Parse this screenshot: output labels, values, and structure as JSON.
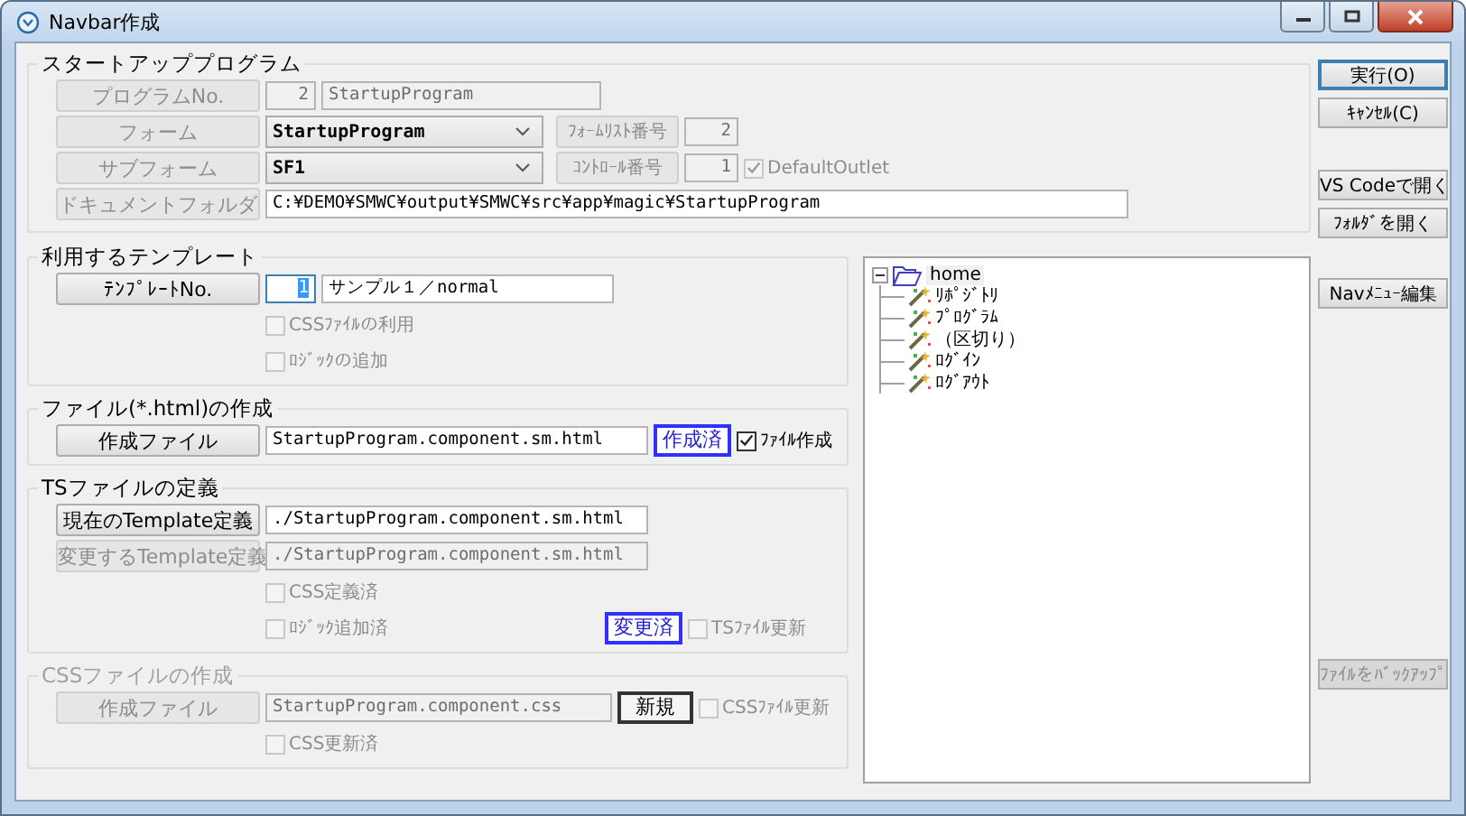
{
  "window": {
    "title": "Navbar作成"
  },
  "startup": {
    "legend": "スタートアッププログラム",
    "program_button": {
      "label": "プログラムNo.",
      "disabled": true
    },
    "program_no": "2",
    "program_name": "StartupProgram",
    "form_button": {
      "label": "フォーム",
      "disabled": true
    },
    "form_select": "StartupProgram",
    "form_list_button": {
      "label": "ﾌｫｰﾑﾘｽﾄ番号",
      "disabled": true
    },
    "form_list_no": "2",
    "subform_button": {
      "label": "サブフォーム",
      "disabled": true
    },
    "subform_select": "SF1",
    "control_button": {
      "label": "ｺﾝﾄﾛｰﾙ番号",
      "disabled": true
    },
    "control_no": "1",
    "default_outlet": {
      "label": "DefaultOutlet",
      "checked": true,
      "disabled": true
    },
    "folder_button": {
      "label": "ドキュメントフォルダ",
      "disabled": true
    },
    "folder_path": "C:¥DEMO¥SMWC¥output¥SMWC¥src¥app¥magic¥StartupProgram"
  },
  "template": {
    "legend": "利用するテンプレート",
    "button": {
      "label": "ﾃﾝﾌﾟﾚｰﾄNo.",
      "disabled": false
    },
    "number": "1",
    "name": "サンプル１／normal",
    "checkboxes": [
      {
        "label": "CSSﾌｧｲﾙの利用",
        "checked": false,
        "disabled": true
      },
      {
        "label": "ﾛｼﾞｯｸの追加",
        "checked": false,
        "disabled": true
      }
    ]
  },
  "html": {
    "legend": "ファイル(*.html)の作成",
    "button": {
      "label": "作成ファイル",
      "disabled": false
    },
    "file": "StartupProgram.component.sm.html",
    "status": "作成済",
    "checkbox": {
      "label": "ﾌｧｲﾙ作成",
      "checked": true,
      "disabled": false
    }
  },
  "ts": {
    "legend": "TSファイルの定義",
    "current_button": {
      "label": "現在のTemplate定義",
      "disabled": false
    },
    "current_value": "./StartupProgram.component.sm.html",
    "change_button": {
      "label": "変更するTemplate定義",
      "disabled": true
    },
    "change_value": "./StartupProgram.component.sm.html",
    "css_defined": {
      "label": "CSS定義済",
      "checked": false,
      "disabled": true
    },
    "logic_added": {
      "label": "ﾛｼﾞｯｸ追加済",
      "checked": false,
      "disabled": true
    },
    "status": "変更済",
    "update": {
      "label": "TSﾌｧｲﾙ更新",
      "checked": false,
      "disabled": true
    }
  },
  "css": {
    "legend": "CSSファイルの作成",
    "disabled": true,
    "button": {
      "label": "作成ファイル",
      "disabled": true
    },
    "file": "StartupProgram.component.css",
    "status": "新規",
    "update": {
      "label": "CSSﾌｧｲﾙ更新",
      "checked": false,
      "disabled": true
    },
    "updated": {
      "label": "CSS更新済",
      "checked": false,
      "disabled": true
    }
  },
  "tree": {
    "root": {
      "label": "home",
      "expanded": true,
      "children": [
        {
          "label": "ﾘﾎﾟｼﾞﾄﾘ"
        },
        {
          "label": "ﾌﾟﾛｸﾞﾗﾑ"
        },
        {
          "label": "（区切り）"
        },
        {
          "label": "ﾛｸﾞｲﾝ"
        },
        {
          "label": "ﾛｸﾞｱｳﾄ"
        }
      ]
    }
  },
  "side_buttons": [
    {
      "label": "実行(O)",
      "default": true,
      "disabled": false
    },
    {
      "label": "ｷｬﾝｾﾙ(C)",
      "default": false,
      "disabled": false
    },
    {
      "label": "VS Codeで開く",
      "default": false,
      "disabled": false
    },
    {
      "label": "ﾌｫﾙﾀﾞを開く",
      "default": false,
      "disabled": false
    },
    {
      "label": "Navﾒﾆｭｰ編集",
      "default": false,
      "disabled": false
    },
    {
      "label": "ﾌｧｲﾙをﾊﾞｯｸｱｯﾌﾟ",
      "default": false,
      "disabled": true
    }
  ]
}
